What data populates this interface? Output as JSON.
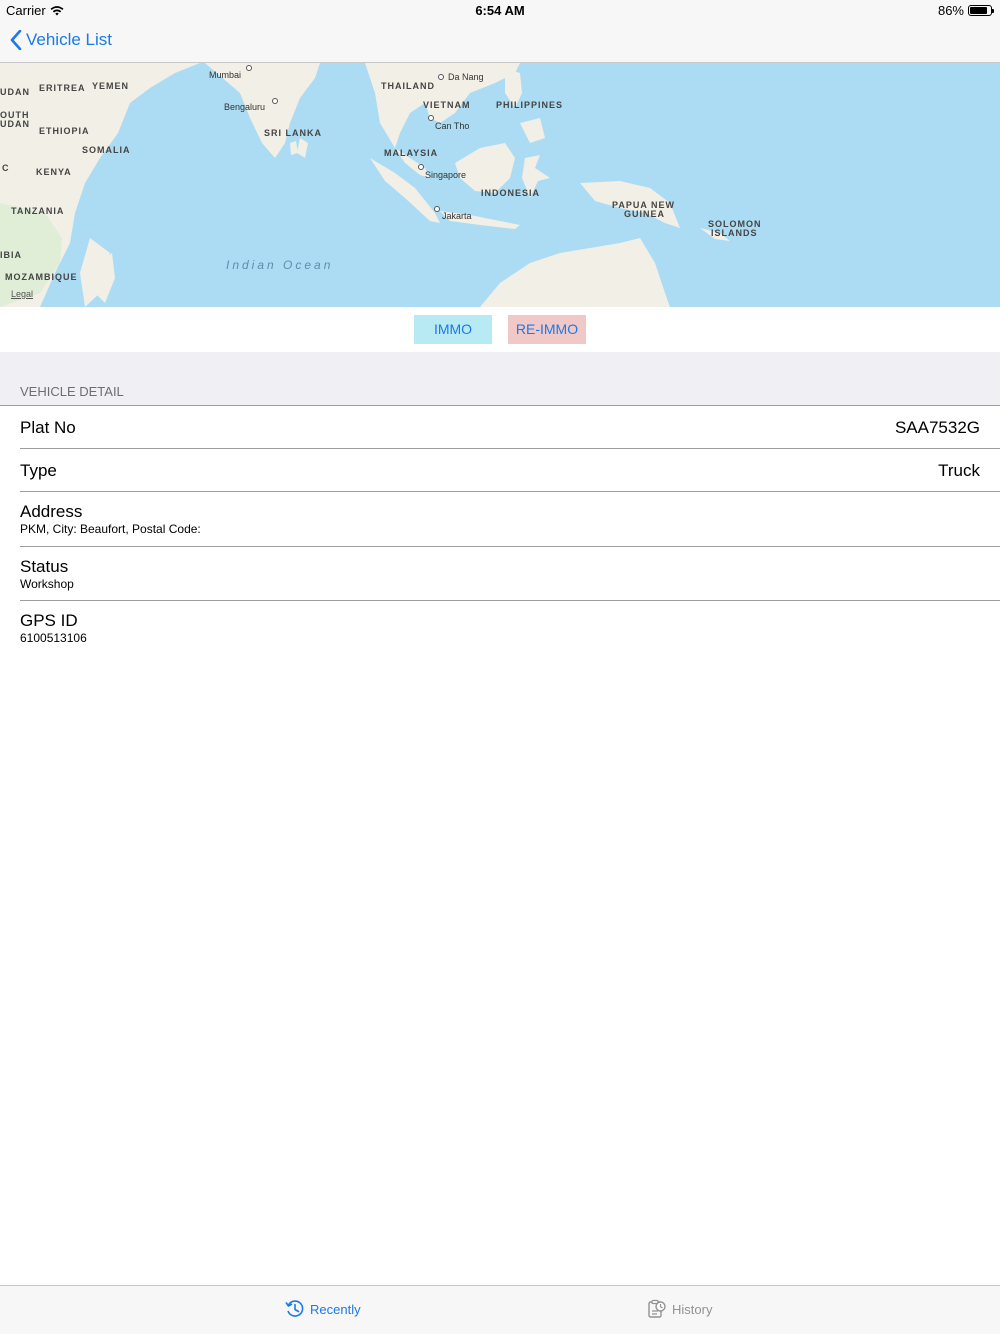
{
  "status_bar": {
    "carrier": "Carrier",
    "time": "6:54 AM",
    "battery": "86%"
  },
  "nav": {
    "back_label": "Vehicle List"
  },
  "map": {
    "labels": {
      "udan": "UDAN",
      "eritrea": "ERITREA",
      "yemen": "YEMEN",
      "south": "OUTH",
      "sudan2": "UDAN",
      "ethiopia": "ETHIOPIA",
      "somalia": "SOMALIA",
      "kenya": "KENYA",
      "c": "C",
      "tanzania": "TANZANIA",
      "ibia": "IBIA",
      "mozambique": "MOZAMBIQUE",
      "sri_lanka": "SRI LANKA",
      "thailand": "THAILAND",
      "vietnam": "VIETNAM",
      "philippines": "PHILIPPINES",
      "malaysia": "MALAYSIA",
      "indonesia": "INDONESIA",
      "png1": "PAPUA NEW",
      "png2": "GUINEA",
      "sol1": "SOLOMON",
      "sol2": "ISLANDS"
    },
    "cities": {
      "mumbai": "Mumbai",
      "bengaluru": "Bengaluru",
      "da_nang": "Da Nang",
      "can_tho": "Can Tho",
      "singapore": "Singapore",
      "jakarta": "Jakarta"
    },
    "ocean": "Indian Ocean",
    "legal": "Legal"
  },
  "actions": {
    "immo": "IMMO",
    "reimmo": "RE-IMMO"
  },
  "detail": {
    "header": "VEHICLE DETAIL",
    "plat_label": "Plat No",
    "plat_value": "SAA7532G",
    "type_label": "Type",
    "type_value": "Truck",
    "address_label": "Address",
    "address_value": "PKM, City: Beaufort, Postal Code:",
    "status_label": "Status",
    "status_value": "Workshop",
    "gps_label": "GPS ID",
    "gps_value": "6100513106"
  },
  "tabs": {
    "recently": "Recently",
    "history": "History"
  },
  "colors": {
    "accent": "#1a7ae8",
    "immo_bg": "#b8eaf4",
    "reimmo_bg": "#f0c8c8",
    "water": "#abdcf4",
    "land": "#f2efe6"
  }
}
